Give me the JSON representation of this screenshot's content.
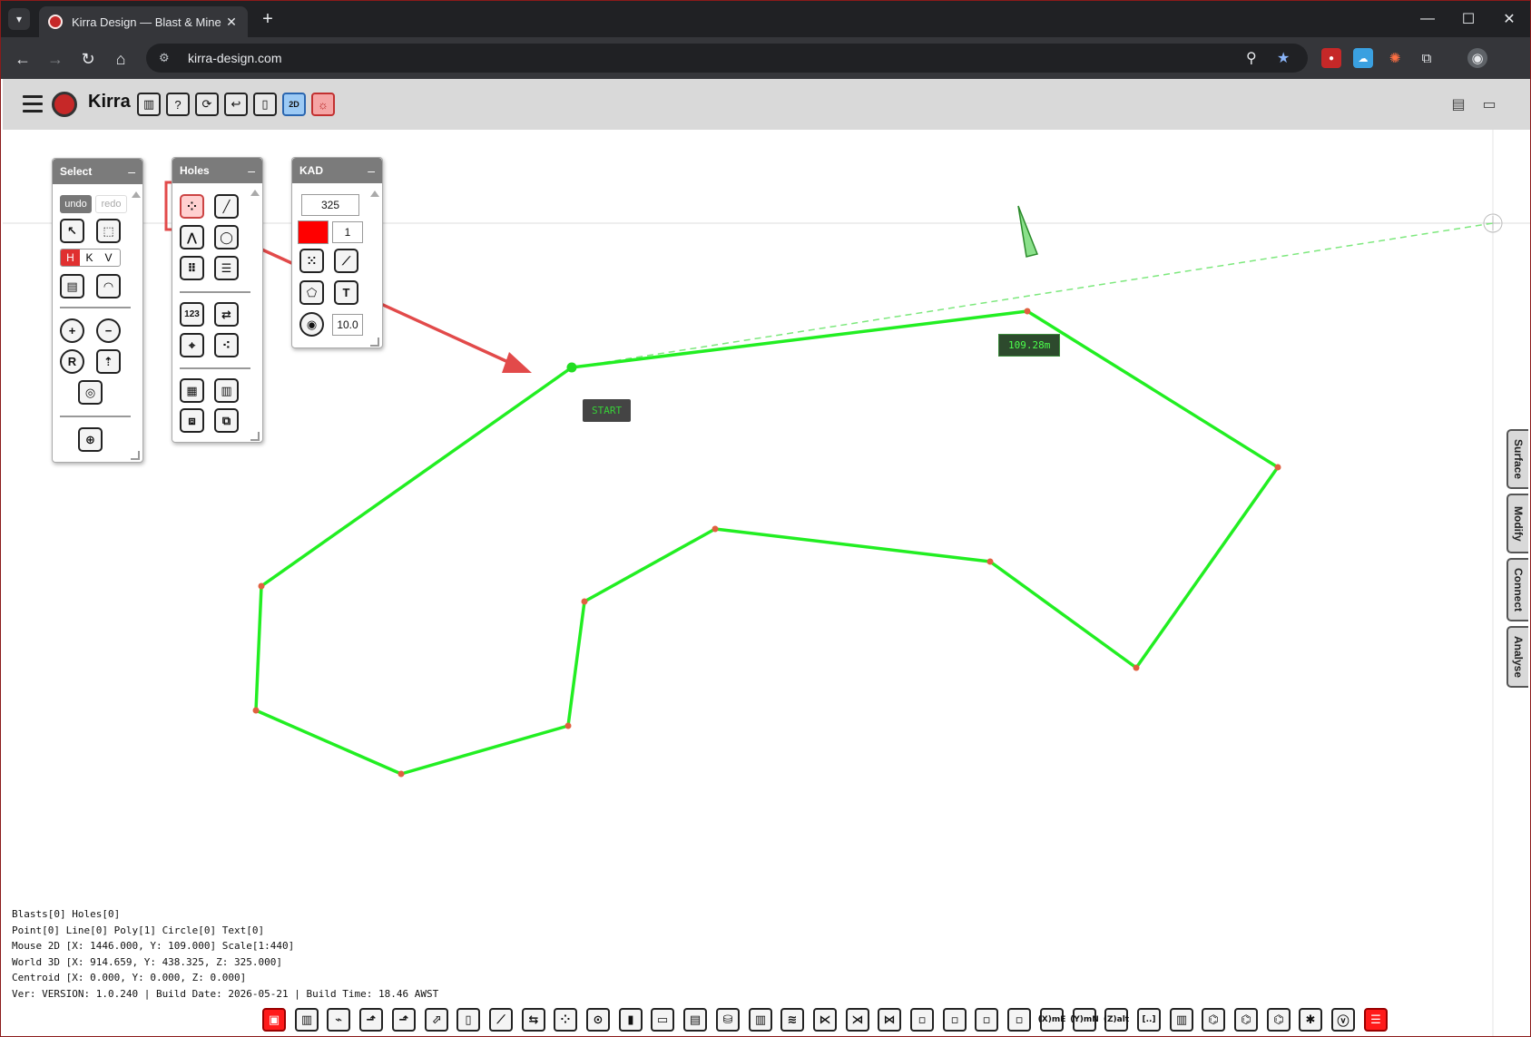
{
  "browser": {
    "tab_title": "Kirra Design — Blast & Mine De",
    "url": "kirra-design.com",
    "icons": [
      "tab-list-icon",
      "close-icon",
      "new-tab-icon",
      "minimize-icon",
      "maximize-icon",
      "window-close-icon",
      "back-icon",
      "forward-icon",
      "reload-icon",
      "home-icon",
      "site-info-icon",
      "zoom-icon",
      "bookmark-star-icon",
      "extensions-icon",
      "profile-icon"
    ]
  },
  "app": {
    "title": "Kirra",
    "header_buttons": [
      "book-icon",
      "help-icon",
      "sync-icon",
      "undo-arrow-icon",
      "layout-icon",
      "2d-3d-toggle",
      "theme-sun-icon"
    ],
    "mode_label": "2D"
  },
  "panels": {
    "select": {
      "title": "Select",
      "undo": "undo",
      "redo": "redo",
      "hkv": [
        "H",
        "K",
        "V"
      ]
    },
    "holes": {
      "title": "Holes"
    },
    "kad": {
      "title": "KAD",
      "elevation": "325",
      "line_width": "1",
      "radius": "10.0",
      "color": "#ff0000"
    }
  },
  "canvas": {
    "distance_label": "109.28m",
    "start_label": "START",
    "line_color": "#22ee22"
  },
  "side_tabs": [
    "Surface",
    "Modify",
    "Connect",
    "Analyse"
  ],
  "status": {
    "line1": "Blasts[0] Holes[0]",
    "line2": "Point[0] Line[0] Poly[1] Circle[0] Text[0]",
    "line3": "Mouse 2D [X: 1446.000, Y: 109.000] Scale[1:440]",
    "line4": "World 3D [X: 914.659, Y: 438.325, Z: 325.000]",
    "line5": "Centroid [X: 0.000, Y: 0.000, Z: 0.000]",
    "line6": "Ver: VERSION: 1.0.240 | Build Date: 2026-05-21 | Build Time: 18.46 AWST"
  },
  "bottom_toolbar": {
    "labels": [
      "",
      "",
      "",
      "",
      "",
      "",
      "",
      "",
      "",
      "",
      "",
      "",
      "",
      "",
      "",
      "",
      "",
      "",
      "",
      "",
      "",
      "",
      "",
      "",
      "(X)mE",
      "(Y)mN",
      "(Z)alt",
      "[..]",
      "",
      "",
      "",
      "",
      "",
      "",
      ""
    ]
  }
}
